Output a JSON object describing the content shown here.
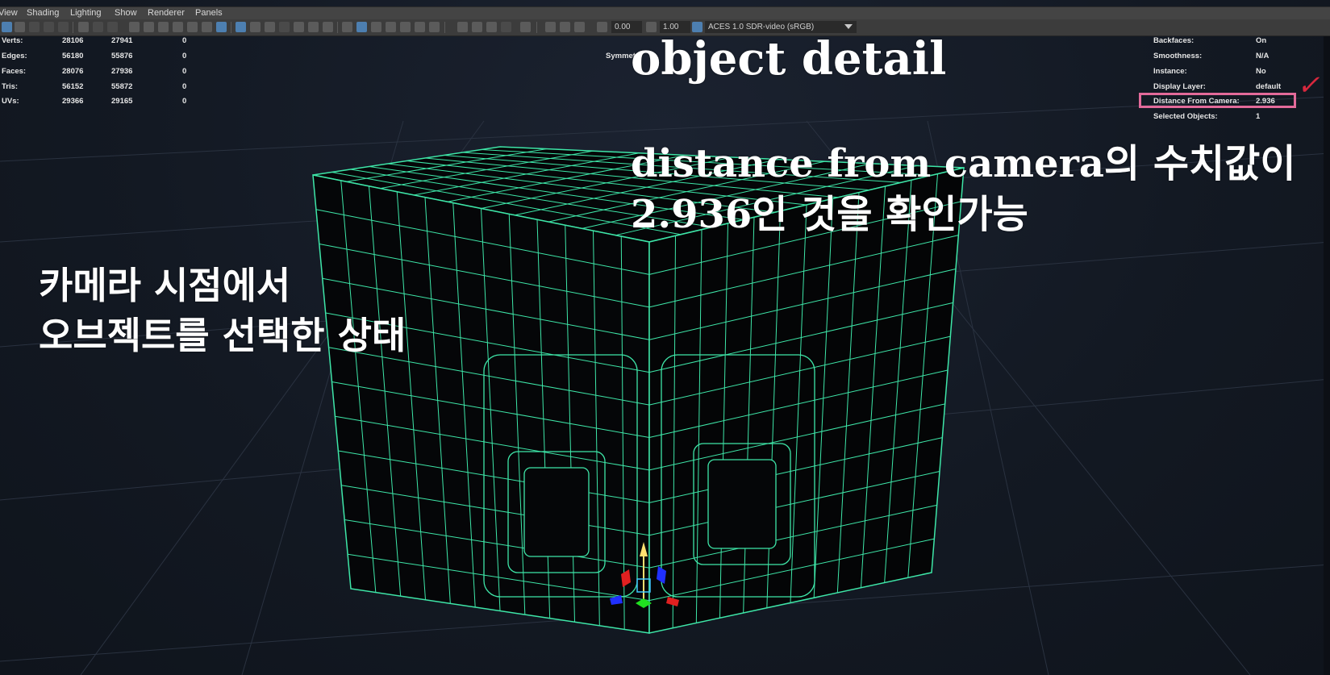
{
  "menu": {
    "items": [
      "View",
      "Shading",
      "Lighting",
      "Show",
      "Renderer",
      "Panels"
    ]
  },
  "toolbar": {
    "exposure": "0.00",
    "gamma": "1.00",
    "color_transform": "ACES 1.0 SDR-video (sRGB)"
  },
  "hud_left": {
    "rows": [
      {
        "label": "Verts:",
        "a": "28106",
        "b": "27941",
        "c": "0"
      },
      {
        "label": "Edges:",
        "a": "56180",
        "b": "55876",
        "c": "0"
      },
      {
        "label": "Faces:",
        "a": "28076",
        "b": "27936",
        "c": "0"
      },
      {
        "label": "Tris:",
        "a": "56152",
        "b": "55872",
        "c": "0"
      },
      {
        "label": "UVs:",
        "a": "29366",
        "b": "29165",
        "c": "0"
      }
    ]
  },
  "hud_center": {
    "symmetry_label": "Symmet"
  },
  "hud_right": {
    "rows": [
      {
        "label": "Backfaces:",
        "value": "On"
      },
      {
        "label": "Smoothness:",
        "value": "N/A"
      },
      {
        "label": "Instance:",
        "value": "No"
      },
      {
        "label": "Display Layer:",
        "value": "default"
      },
      {
        "label": "Distance From Camera:",
        "value": "2.936"
      },
      {
        "label": "Selected Objects:",
        "value": "1"
      }
    ]
  },
  "annotations": {
    "title": "object detail",
    "note_line1": "distance from camera의 수치값이",
    "note_line2": "2.936인 것을 확인가능",
    "left_line1": "카메라 시점에서",
    "left_line2": "오브젝트를 선택한 상태",
    "check": "✓"
  },
  "colors": {
    "wire": "#3ee6a8",
    "highlight": "#e36a9a",
    "check": "#d8283e",
    "menubar": "#444444",
    "toolbar": "#3c3c3c"
  }
}
